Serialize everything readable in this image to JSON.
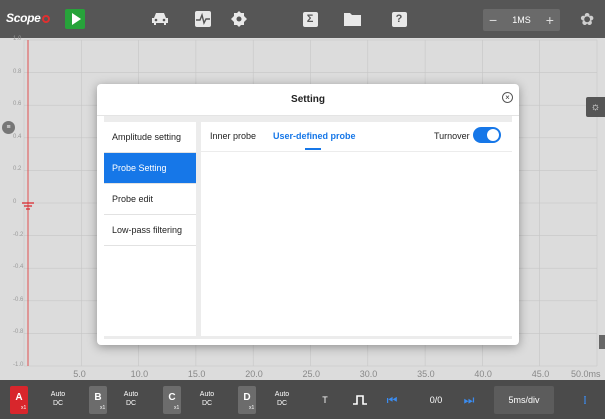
{
  "toolbar": {
    "logo": "Scope",
    "timebase": "1MS",
    "minus": "−",
    "plus": "+",
    "math_icon": "Σ",
    "help_icon": "?"
  },
  "scope": {
    "y_ticks": [
      "1.0",
      "0.8",
      "0.6",
      "0.4",
      "0.2",
      "0",
      "-0.2",
      "-0.4",
      "-0.6",
      "-0.8",
      "-1.0"
    ],
    "x_ticks": [
      "5.0",
      "10.0",
      "15.0",
      "20.0",
      "25.0",
      "30.0",
      "35.0",
      "40.0",
      "45.0",
      "50.0ms"
    ]
  },
  "modal": {
    "title": "Setting",
    "close": "×",
    "sidebar": [
      {
        "label": "Amplitude setting"
      },
      {
        "label": "Probe Setting"
      },
      {
        "label": "Probe edit"
      },
      {
        "label": "Low-pass filtering"
      }
    ],
    "tabs": [
      {
        "label": "Inner probe"
      },
      {
        "label": "User-defined probe"
      }
    ],
    "turnover_label": "Turnover",
    "turnover_on": true
  },
  "bottom": {
    "channels": [
      {
        "letter": "A",
        "sub": "x1",
        "color": "#d8262c",
        "coupling1": "Auto",
        "coupling2": "DC"
      },
      {
        "letter": "B",
        "sub": "x1",
        "color": "#6c6c6c",
        "coupling1": "Auto",
        "coupling2": "DC"
      },
      {
        "letter": "C",
        "sub": "x1",
        "color": "#6c6c6c",
        "coupling1": "Auto",
        "coupling2": "DC"
      },
      {
        "letter": "D",
        "sub": "x1",
        "color": "#6c6c6c",
        "coupling1": "Auto",
        "coupling2": "DC"
      }
    ],
    "trigger_label": "T",
    "page": "0/0",
    "timediv": "5ms/div"
  },
  "colors": {
    "accent": "#1677e8",
    "play": "#27a33a",
    "channel_a": "#d8262c"
  }
}
